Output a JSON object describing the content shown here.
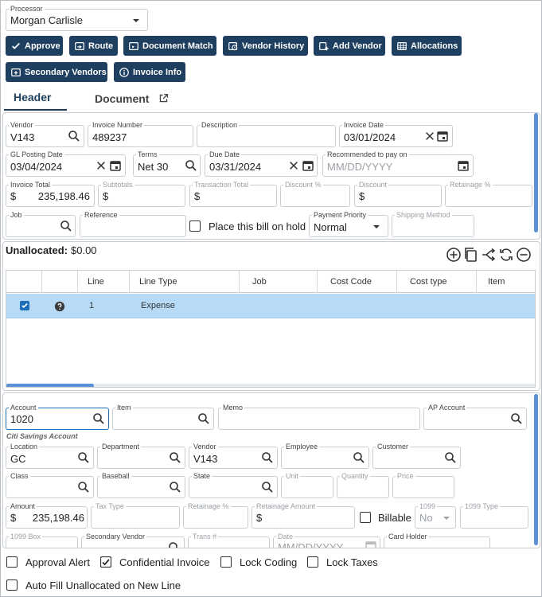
{
  "processor": {
    "label": "Processor",
    "value": "Morgan Carlisle"
  },
  "actions": {
    "approve": "Approve",
    "route": "Route",
    "document_match": "Document Match",
    "vendor_history": "Vendor History",
    "add_vendor": "Add Vendor",
    "allocations": "Allocations",
    "secondary_vendors": "Secondary Vendors",
    "invoice_info": "Invoice Info"
  },
  "tabs": {
    "header": "Header",
    "document": "Document"
  },
  "header": {
    "vendor": {
      "label": "Vendor",
      "value": "V143"
    },
    "invoice_number": {
      "label": "Invoice Number",
      "value": "489237"
    },
    "description": {
      "label": "Description",
      "value": ""
    },
    "invoice_date": {
      "label": "Invoice Date",
      "value": "03/01/2024"
    },
    "gl_posting_date": {
      "label": "GL Posting Date",
      "value": "03/04/2024"
    },
    "terms": {
      "label": "Terms",
      "value": "Net 30"
    },
    "due_date": {
      "label": "Due Date",
      "value": "03/31/2024"
    },
    "recommended": {
      "label": "Recommended to pay on",
      "placeholder": "MM/DD/YYYY"
    },
    "invoice_total": {
      "label": "Invoice Total",
      "currency": "$",
      "value": "235,198.46"
    },
    "subtotals": {
      "label": "Subtotals",
      "currency": "$"
    },
    "transaction_total": {
      "label": "Transaction Total",
      "currency": "$"
    },
    "discount_pct": {
      "label": "Discount %"
    },
    "discount": {
      "label": "Discount",
      "currency": "$"
    },
    "retainage_pct": {
      "label": "Retainage %"
    },
    "job": {
      "label": "Job"
    },
    "reference": {
      "label": "Reference"
    },
    "hold": {
      "label": "Place this bill on hold"
    },
    "payment_priority": {
      "label": "Payment Priority",
      "value": "Normal"
    },
    "shipping_method": {
      "label": "Shipping Method"
    }
  },
  "lines": {
    "unallocated_label": "Unallocated:",
    "unallocated_value": "$0.00",
    "columns": [
      "Line",
      "Line Type",
      "Job",
      "Cost Code",
      "Cost type",
      "Item"
    ],
    "rows": [
      {
        "line": "1",
        "line_type": "Expense",
        "checked": true
      }
    ]
  },
  "detail": {
    "account": {
      "label": "Account",
      "value": "1020",
      "hint": "Citi Savings Account"
    },
    "item": {
      "label": "Item"
    },
    "memo": {
      "label": "Memo"
    },
    "ap_account": {
      "label": "AP Account"
    },
    "location": {
      "label": "Location",
      "value": "GC"
    },
    "department": {
      "label": "Department"
    },
    "vendor": {
      "label": "Vendor",
      "value": "V143"
    },
    "employee": {
      "label": "Employee"
    },
    "customer": {
      "label": "Customer"
    },
    "class": {
      "label": "Class"
    },
    "baseball": {
      "label": "Baseball"
    },
    "state": {
      "label": "State"
    },
    "unit": {
      "label": "Unit"
    },
    "quantity": {
      "label": "Quantity"
    },
    "price": {
      "label": "Price"
    },
    "amount": {
      "label": "Amount",
      "currency": "$",
      "value": "235,198.46"
    },
    "tax_type": {
      "label": "Tax Type"
    },
    "retainage_pct": {
      "label": "Retainage %"
    },
    "retainage_amount": {
      "label": "Retainage Amount",
      "currency": "$"
    },
    "billable": {
      "label": "Billable"
    },
    "f1099": {
      "label": "1099",
      "value": "No"
    },
    "f1099_type": {
      "label": "1099 Type"
    },
    "f1099_box": {
      "label": "1099 Box"
    },
    "secondary_vendor": {
      "label": "Secondary Vendor"
    },
    "trans_no": {
      "label": "Trans #"
    },
    "date": {
      "label": "Date",
      "placeholder": "MM/DD/YYYY"
    },
    "card_holder": {
      "label": "Card Holder"
    }
  },
  "footer": {
    "approval_alert": {
      "label": "Approval Alert",
      "checked": false
    },
    "confidential_invoice": {
      "label": "Confidential Invoice",
      "checked": true
    },
    "lock_coding": {
      "label": "Lock Coding",
      "checked": false
    },
    "lock_taxes": {
      "label": "Lock Taxes",
      "checked": false
    },
    "auto_fill": {
      "label": "Auto Fill Unallocated on New Line",
      "checked": false
    }
  },
  "colors": {
    "primary": "#1e3f5f",
    "selected_row": "#b7dbf7",
    "focus": "#1e6fb8",
    "scroll": "#5b8fd6"
  }
}
